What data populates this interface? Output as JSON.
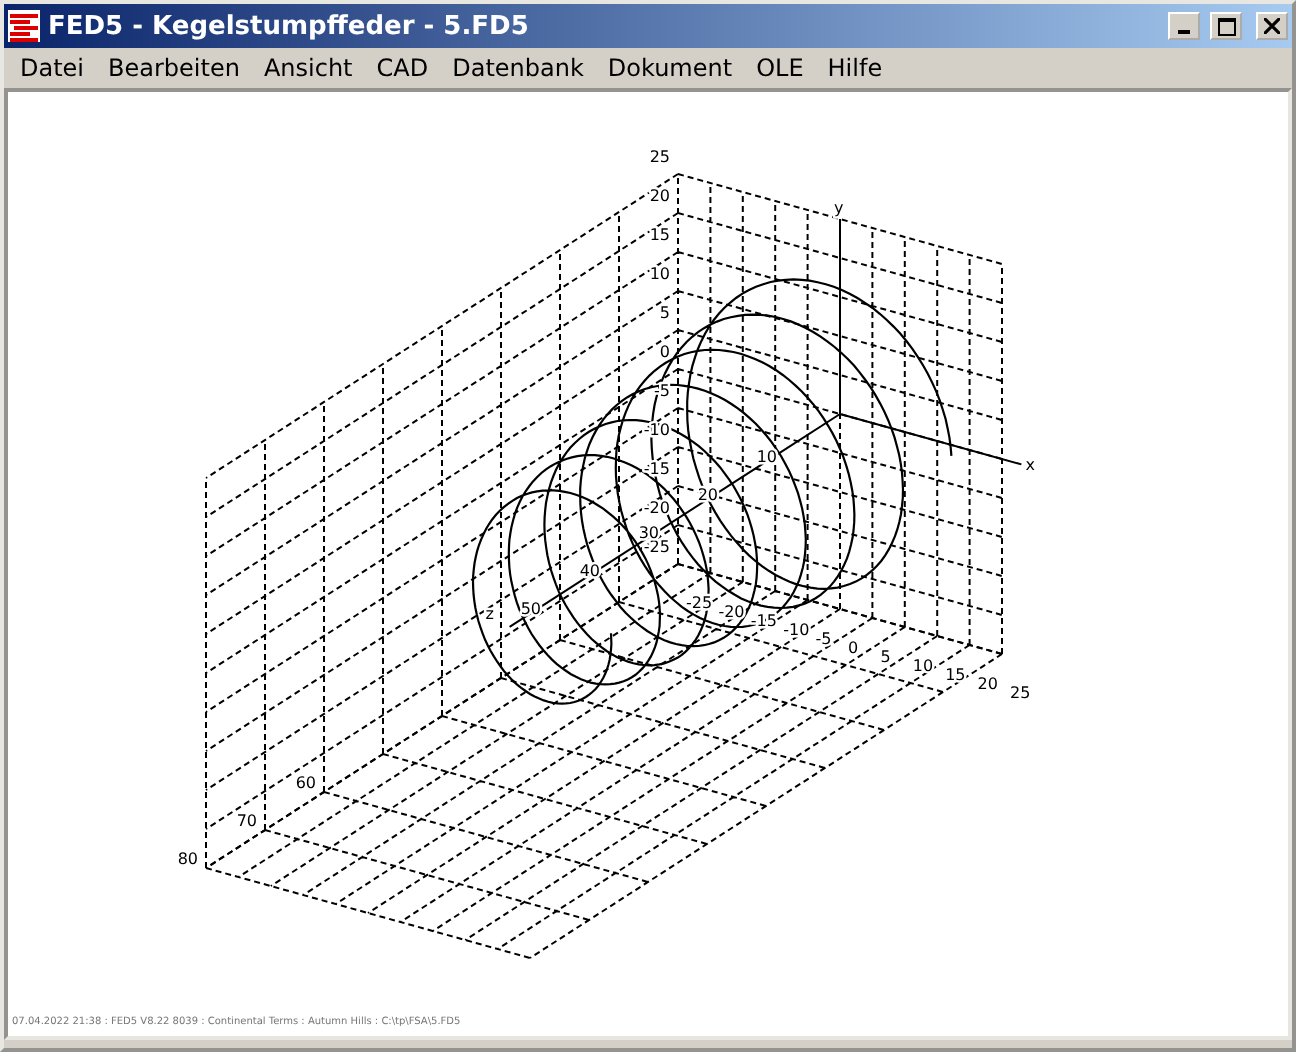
{
  "window": {
    "title": "FED5  -  Kegelstumpffeder  -  5.FD5"
  },
  "menu": [
    "Datei",
    "Bearbeiten",
    "Ansicht",
    "CAD",
    "Datenbank",
    "Dokument",
    "OLE",
    "Hilfe"
  ],
  "plot": {
    "y_ticks": [
      "25",
      "20",
      "15",
      "10",
      "5",
      "0",
      "-5",
      "-10",
      "-15",
      "-20",
      "-25"
    ],
    "x_ticks": [
      "-25",
      "-20",
      "-15",
      "-10",
      "-5",
      "0",
      "5",
      "10",
      "15",
      "20",
      "25"
    ],
    "z_ticks": [
      {
        "label": "10",
        "kind": "axis"
      },
      {
        "label": "20",
        "kind": "axis"
      },
      {
        "label": "30",
        "kind": "axis"
      },
      {
        "label": "40",
        "kind": "axis"
      },
      {
        "label": "50",
        "kind": "axis"
      },
      {
        "label": "60",
        "kind": "edge"
      },
      {
        "label": "70",
        "kind": "edge"
      },
      {
        "label": "80",
        "kind": "edge"
      }
    ],
    "axis_labels": {
      "x": "x",
      "y": "y",
      "z": "z"
    }
  },
  "footer": "07.04.2022 21:38 : FED5 V8.22 8039 : Continental Terms : Autumn Hills : C:\\tp\\FSA\\5.FD5"
}
